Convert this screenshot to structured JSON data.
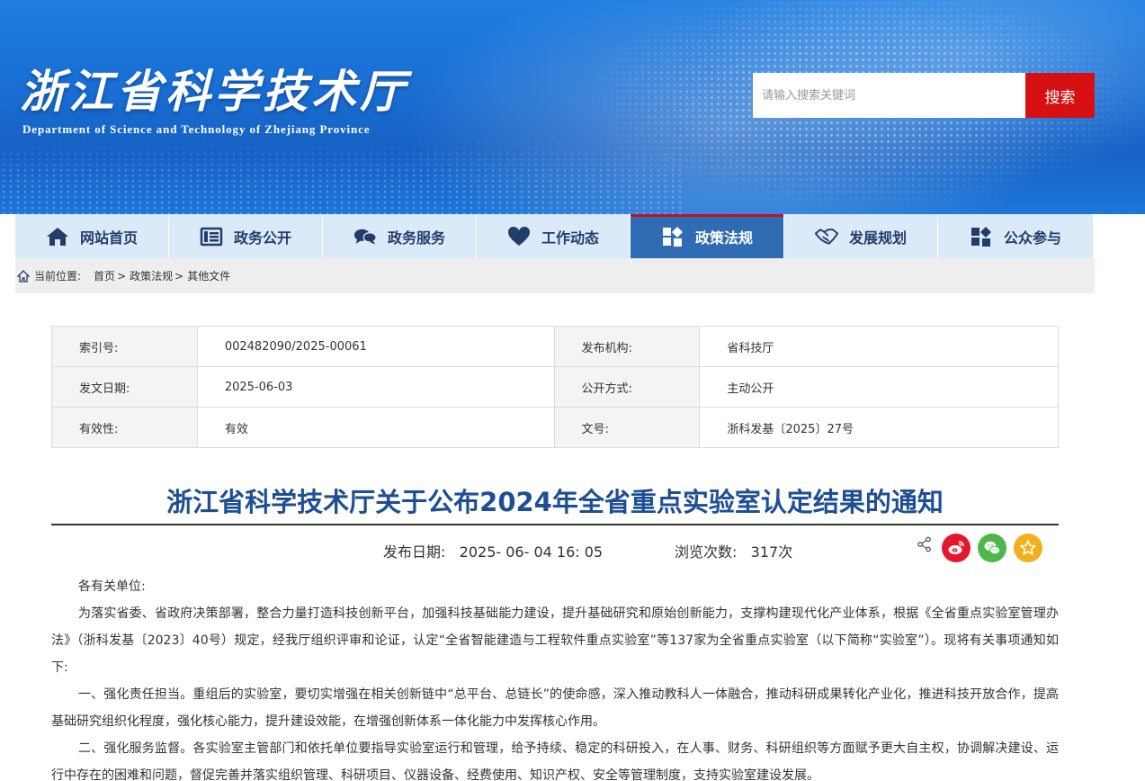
{
  "header": {
    "title_cn": "浙江省科学技术厅",
    "title_en": "Department of Science and Technology of Zhejiang Province",
    "search": {
      "placeholder": "请输入搜索关键词",
      "button_label": "搜索"
    }
  },
  "nav": {
    "items": [
      {
        "label": "网站首页",
        "icon": "home-icon",
        "active": false
      },
      {
        "label": "政务公开",
        "icon": "list-icon",
        "active": false
      },
      {
        "label": "政务服务",
        "icon": "chat-bubbles-icon",
        "active": false
      },
      {
        "label": "工作动态",
        "icon": "heart-icon",
        "active": false
      },
      {
        "label": "政策法规",
        "icon": "policy-icon",
        "active": true
      },
      {
        "label": "发展规划",
        "icon": "handshake-icon",
        "active": false
      },
      {
        "label": "公众参与",
        "icon": "participation-icon",
        "active": false
      }
    ]
  },
  "breadcrumb": {
    "label": "当前位置:",
    "items": [
      "首页",
      "政策法规",
      "其他文件"
    ],
    "separator": ">"
  },
  "meta": {
    "index_label": "索引号:",
    "index_value": "002482090/2025-00061",
    "org_label": "发布机构:",
    "org_value": "省科技厅",
    "date_label": "发文日期:",
    "date_value": "2025-06-03",
    "mode_label": "公开方式:",
    "mode_value": "主动公开",
    "validity_label": "有效性:",
    "validity_value": "有效",
    "doc_no_label": "文号:",
    "doc_no_value": "浙科发基〔2025〕27号"
  },
  "article": {
    "title": "浙江省科学技术厅关于公布2024年全省重点实验室认定结果的通知",
    "publish_label": "发布日期:",
    "publish_value": "2025- 06- 04 16: 05",
    "views_label": "浏览次数:",
    "views_value": "317次",
    "greeting": "各有关单位:",
    "paragraphs": [
      "为落实省委、省政府决策部署，整合力量打造科技创新平台，加强科技基础能力建设，提升基础研究和原始创新能力，支撑构建现代化产业体系，根据《全省重点实验室管理办法》（浙科发基〔2023〕40号）规定，经我厅组织评审和论证，认定“全省智能建造与工程软件重点实验室”等137家为全省重点实验室（以下简称“实验室”）。现将有关事项通知如下:",
      "一、强化责任担当。重组后的实验室，要切实增强在相关创新链中“总平台、总链长”的使命感，深入推动教科人一体融合，推动科研成果转化产业化，推进科技开放合作，提高基础研究组织化程度，强化核心能力，提升建设效能，在增强创新体系一体化能力中发挥核心作用。",
      "二、强化服务监督。各实验室主管部门和依托单位要指导实验室运行和管理，给予持续、稳定的科研投入，在人事、财务、科研组织等方面赋予更大自主权，协调解决建设、运行中存在的困难和问题，督促完善并落实组织管理、科研项目、仪器设备、经费使用、知识产权、安全等管理制度，支持实验室建设发展。"
    ]
  },
  "share": {
    "icons": [
      "share-icon",
      "weibo-icon",
      "wechat-icon",
      "favorite-star-icon"
    ],
    "colors": {
      "weibo": "#e6162d",
      "wechat": "#4cb84a",
      "favorite": "#f3b01c"
    }
  },
  "colors": {
    "nav_active_bg": "#2f6cb3",
    "nav_bg": "#dbeaf8",
    "search_button": "#d60f12",
    "title_blue": "#1e4f95"
  }
}
